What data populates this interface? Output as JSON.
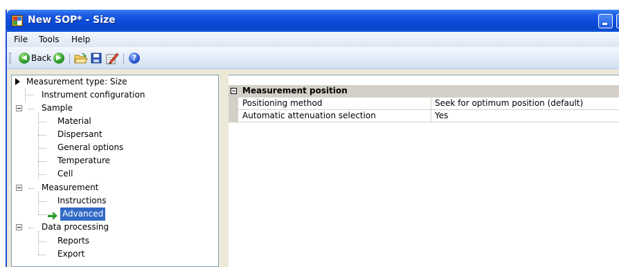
{
  "window": {
    "title": "New SOP* - Size"
  },
  "menu": {
    "items": [
      "File",
      "Tools",
      "Help"
    ]
  },
  "toolbar": {
    "back_label": "Back"
  },
  "tree": {
    "root": "Measurement type: Size",
    "items": {
      "instrument_configuration": "Instrument configuration",
      "sample": "Sample",
      "material": "Material",
      "dispersant": "Dispersant",
      "general_options": "General options",
      "temperature": "Temperature",
      "cell": "Cell",
      "measurement": "Measurement",
      "instructions": "Instructions",
      "advanced": "Advanced",
      "data_processing": "Data processing",
      "reports": "Reports",
      "export": "Export"
    },
    "selected": "Advanced"
  },
  "properties": {
    "category": "Measurement position",
    "rows": [
      {
        "name": "Positioning method",
        "value": "Seek for optimum position (default)"
      },
      {
        "name": "Automatic attenuation selection",
        "value": "Yes"
      }
    ]
  },
  "colors": {
    "titlebar": "#0b4bd8",
    "selection": "#316ac5",
    "window": "#ece9d8"
  },
  "icons": [
    "app-icon",
    "back-icon",
    "forward-icon",
    "open-folder-icon",
    "save-icon",
    "edit-icon",
    "help-icon",
    "collapse-icon",
    "expand-arrow-icon",
    "current-item-arrow-icon"
  ]
}
